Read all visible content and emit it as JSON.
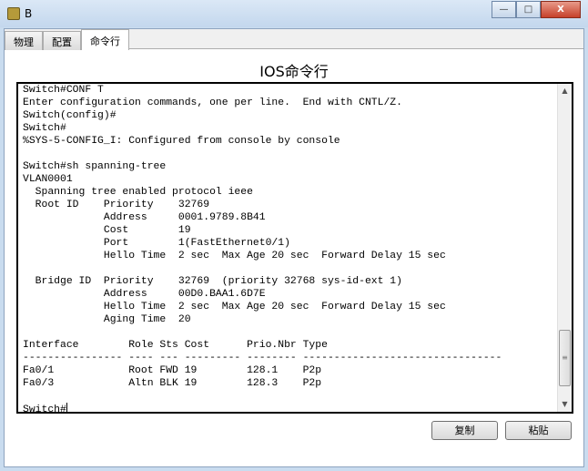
{
  "window": {
    "title": "B",
    "minimize": "—",
    "maximize": "□",
    "close": "X"
  },
  "tabs": [
    {
      "label": "物理"
    },
    {
      "label": "配置"
    },
    {
      "label": "命令行",
      "active": true
    }
  ],
  "panel_title": "IOS命令行",
  "terminal": {
    "lines": [
      "Switch#CONF T",
      "Enter configuration commands, one per line.  End with CNTL/Z.",
      "Switch(config)#",
      "Switch#",
      "%SYS-5-CONFIG_I: Configured from console by console",
      "",
      "Switch#sh spanning-tree",
      "VLAN0001",
      "  Spanning tree enabled protocol ieee",
      "  Root ID    Priority    32769",
      "             Address     0001.9789.8B41",
      "             Cost        19",
      "             Port        1(FastEthernet0/1)",
      "             Hello Time  2 sec  Max Age 20 sec  Forward Delay 15 sec",
      "",
      "  Bridge ID  Priority    32769  (priority 32768 sys-id-ext 1)",
      "             Address     00D0.BAA1.6D7E",
      "             Hello Time  2 sec  Max Age 20 sec  Forward Delay 15 sec",
      "             Aging Time  20",
      "",
      "Interface        Role Sts Cost      Prio.Nbr Type",
      "---------------- ---- --- --------- -------- --------------------------------",
      "Fa0/1            Root FWD 19        128.1    P2p",
      "Fa0/3            Altn BLK 19        128.3    P2p",
      ""
    ],
    "prompt": "Switch#"
  },
  "buttons": {
    "copy": "复制",
    "paste": "粘贴"
  }
}
